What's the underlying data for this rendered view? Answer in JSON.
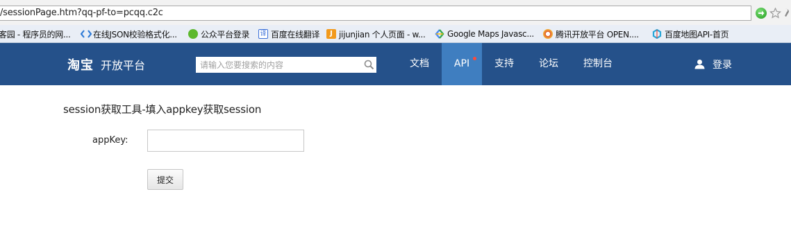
{
  "browser": {
    "url": "/sessionPage.htm?qq-pf-to=pcqq.c2c",
    "icons": {
      "go": "go-arrow-icon",
      "bookmark_star": "star-icon",
      "menu": "wrench-icon"
    }
  },
  "bookmarks": [
    {
      "label": "客园 - 程序员的网...",
      "icon": "blog-icon",
      "color": "#d9d9d9"
    },
    {
      "label": "在线JSON校验格式化...",
      "icon": "json-icon",
      "color": "#2f7bd6"
    },
    {
      "label": "公众平台登录",
      "icon": "wechat-icon",
      "color": "#5cb82d"
    },
    {
      "label": "百度在线翻译",
      "icon": "translate-icon",
      "color": "#3a6fd8"
    },
    {
      "label": "jijunjian 个人页面 - w...",
      "icon": "iteye-icon",
      "color": "#f29a1c"
    },
    {
      "label": "Google Maps Javasc...",
      "icon": "google-icon",
      "color": "#4a8af4"
    },
    {
      "label": "腾讯开放平台 OPEN....",
      "icon": "tencent-icon",
      "color": "#e05a2b"
    },
    {
      "label": "百度地图API-首页",
      "icon": "baidu-map-icon",
      "color": "#2aa7d8"
    }
  ],
  "header": {
    "logo_mark": "淘宝",
    "logo_sub": "开放平台",
    "search": {
      "placeholder": "请输入您要搜索的内容"
    },
    "nav": [
      {
        "label": "文档",
        "active": false
      },
      {
        "label": "API",
        "active": true,
        "has_dot": true
      },
      {
        "label": "支持",
        "active": false
      },
      {
        "label": "论坛",
        "active": false
      },
      {
        "label": "控制台",
        "active": false
      }
    ],
    "login_label": "登录",
    "colors": {
      "bar": "#25518a",
      "active": "#3f7ec0",
      "dot": "#ff4a3a"
    }
  },
  "main": {
    "title": "session获取工具-填入appkey获取session",
    "appkey_label": "appKey:",
    "appkey_value": "",
    "submit_label": "提交"
  }
}
